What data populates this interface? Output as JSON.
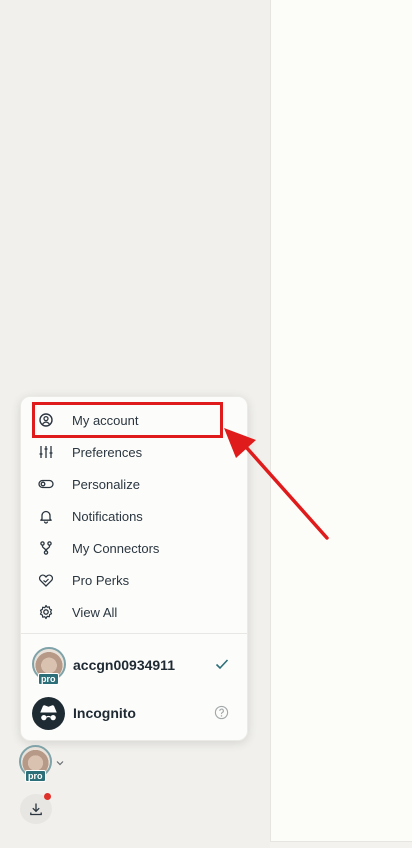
{
  "menu": {
    "items": [
      {
        "label": "My account",
        "icon": "user-circle-icon"
      },
      {
        "label": "Preferences",
        "icon": "sliders-icon"
      },
      {
        "label": "Personalize",
        "icon": "toggle-icon"
      },
      {
        "label": "Notifications",
        "icon": "bell-icon"
      },
      {
        "label": "My Connectors",
        "icon": "connectors-icon"
      },
      {
        "label": "Pro Perks",
        "icon": "perks-icon"
      },
      {
        "label": "View All",
        "icon": "gear-icon"
      }
    ],
    "accounts": [
      {
        "label": "accgn00934911",
        "badge": "pro",
        "selected": true
      },
      {
        "label": "Incognito",
        "icon": "incognito-icon"
      }
    ]
  },
  "user_badge": "pro",
  "colors": {
    "highlight": "#e01b1b",
    "accent": "#2d6f79",
    "notification_dot": "#e0302a"
  }
}
